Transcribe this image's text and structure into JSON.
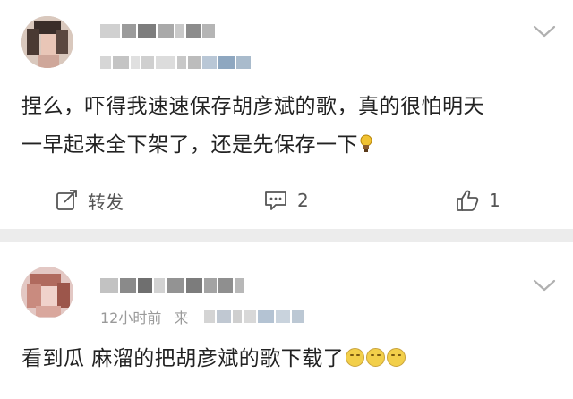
{
  "posts": [
    {
      "author_name": "",
      "meta_visible": "",
      "text_line1": "捏么，吓得我速速保存胡彦斌的歌，真的很怕明天",
      "text_line2": "一早起来全下架了，还是先保存一下",
      "actions": {
        "share_label": "转发",
        "comment_count": "2",
        "like_count": "1"
      }
    },
    {
      "author_name": "",
      "meta_time": "12小时前",
      "meta_source_prefix": "来",
      "text": "看到瓜  麻溜的把胡彦斌的歌下载了"
    }
  ],
  "icons": [
    "avatar",
    "chevron-down-icon",
    "share-icon",
    "comment-icon",
    "like-icon",
    "bulb-emoji",
    "grin-emoji"
  ],
  "colors": {
    "background": "#ffffff",
    "separator": "#ececec",
    "text": "#222222",
    "secondary": "#9a9a9a"
  }
}
